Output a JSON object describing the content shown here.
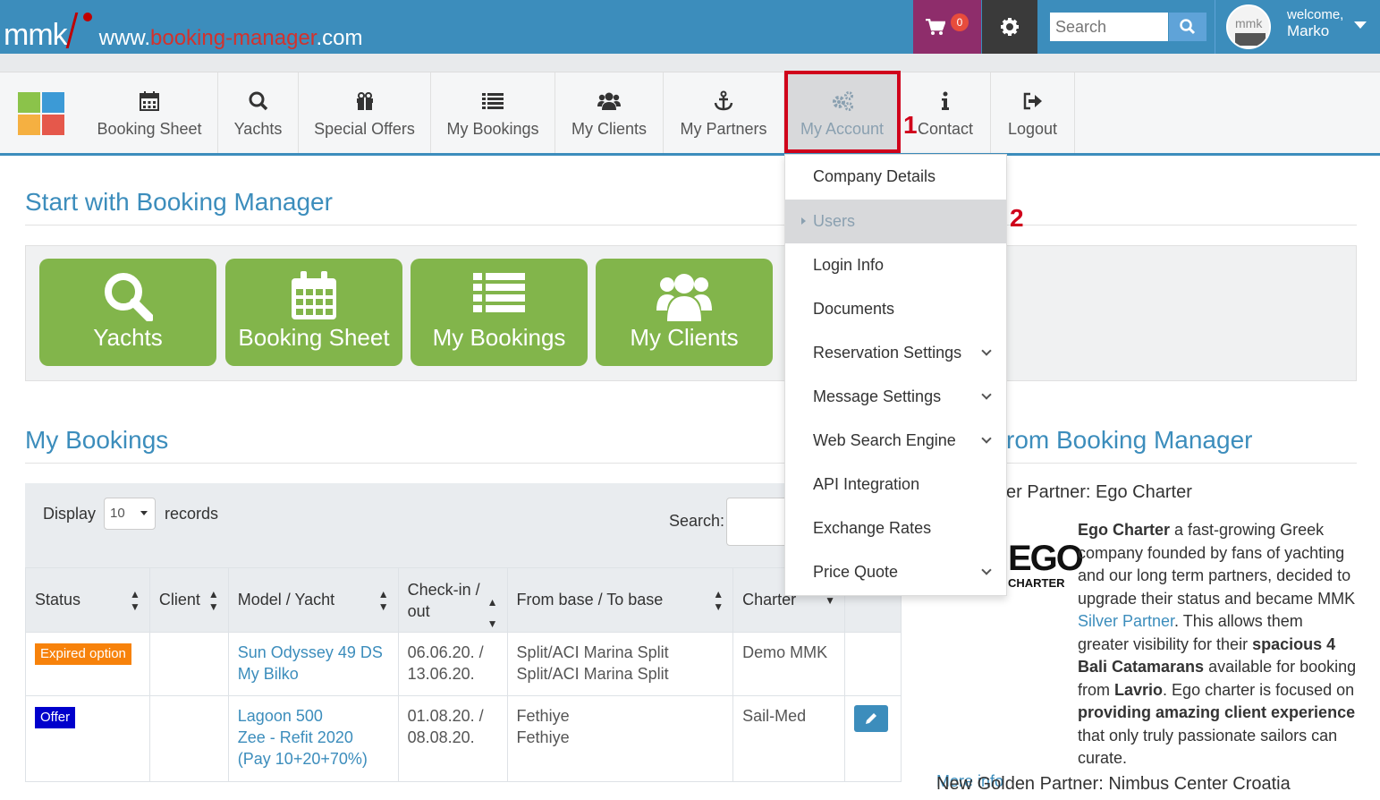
{
  "header": {
    "logo_text": "mmk",
    "url_prefix": "www.",
    "url_brand": "booking-manager",
    "url_suffix": ".com",
    "cart_count": "0",
    "search_placeholder": "Search",
    "welcome": "welcome,",
    "user_name": "Marko",
    "colors": {
      "bar": "#3c8dbc",
      "cart": "#8e2d6b",
      "gear": "#3a3a3a"
    }
  },
  "nav": {
    "items": [
      {
        "label": "Booking Sheet",
        "icon": "calendar-icon"
      },
      {
        "label": "Yachts",
        "icon": "search-icon"
      },
      {
        "label": "Special Offers",
        "icon": "gift-icon"
      },
      {
        "label": "My Bookings",
        "icon": "list-icon"
      },
      {
        "label": "My Clients",
        "icon": "users-icon"
      },
      {
        "label": "My Partners",
        "icon": "anchor-icon"
      },
      {
        "label": "My Account",
        "icon": "gears-icon"
      },
      {
        "label": "Contact",
        "icon": "info-icon"
      },
      {
        "label": "Logout",
        "icon": "sign-out-icon"
      }
    ]
  },
  "annotations": {
    "step1": "1",
    "step2": "2"
  },
  "start": {
    "title": "Start with Booking Manager",
    "buttons": [
      "Yachts",
      "Booking Sheet",
      "My Bookings",
      "My Clients"
    ]
  },
  "dropdown": {
    "items": [
      {
        "label": "Company Details",
        "submenu": false
      },
      {
        "label": "Users",
        "submenu": false,
        "active": true
      },
      {
        "label": "Login Info",
        "submenu": false
      },
      {
        "label": "Documents",
        "submenu": false
      },
      {
        "label": "Reservation Settings",
        "submenu": true
      },
      {
        "label": "Message Settings",
        "submenu": true
      },
      {
        "label": "Web Search Engine",
        "submenu": true
      },
      {
        "label": "API Integration",
        "submenu": false
      },
      {
        "label": "Exchange Rates",
        "submenu": false
      },
      {
        "label": "Price Quote",
        "submenu": true
      }
    ]
  },
  "bookings": {
    "title": "My Bookings",
    "display_label": "Display",
    "records_value": "10",
    "records_label": "records",
    "search_label": "Search:",
    "columns": [
      "Status",
      "Client",
      "Model / Yacht",
      "Check-in / out",
      "From base / To base",
      "Charter"
    ],
    "rows": [
      {
        "status": "Expired option",
        "client": "",
        "model": "Sun Odyssey 49 DS",
        "yacht": "My Bilko",
        "checkin": "06.06.20. /",
        "checkout": "13.06.20.",
        "from": "Split/ACI Marina Split",
        "to": "Split/ACI Marina Split",
        "charter": "Demo MMK"
      },
      {
        "status": "Offer",
        "client": "",
        "model": "Lagoon 500",
        "yacht": "Zee - Refit 2020 (Pay 10+20+70%)",
        "checkin": "01.08.20. /",
        "checkout": "08.08.20.",
        "from": "Fethiye",
        "to": "Fethiye",
        "charter": "Sail-Med"
      }
    ]
  },
  "news": {
    "title_partial": "rom Booking Manager",
    "headline_partial": "er Partner: Ego Charter",
    "logo_text": "EGO",
    "logo_sub": "CHARTER",
    "p1_bold": "Ego Charter",
    "p1_rest": " a fast-growing Greek company founded by fans of yachting and our long term partners, decided to upgrade their status and became MMK ",
    "p1_link": "Silver Partner",
    "p1_rest2": ". This allows them greater visibility for their ",
    "p1_bold2": "spacious 4 Bali Catamarans",
    "p1_rest3": " available for booking from ",
    "p1_bold3": "Lavrio",
    "p1_rest4": ". Ego charter is focused on ",
    "p1_bold4": "providing amazing client experience",
    "p1_rest5": " that only truly passionate sailors can curate.",
    "more_info": "More info",
    "headline2": "New Golden Partner: Nimbus Center Croatia"
  }
}
